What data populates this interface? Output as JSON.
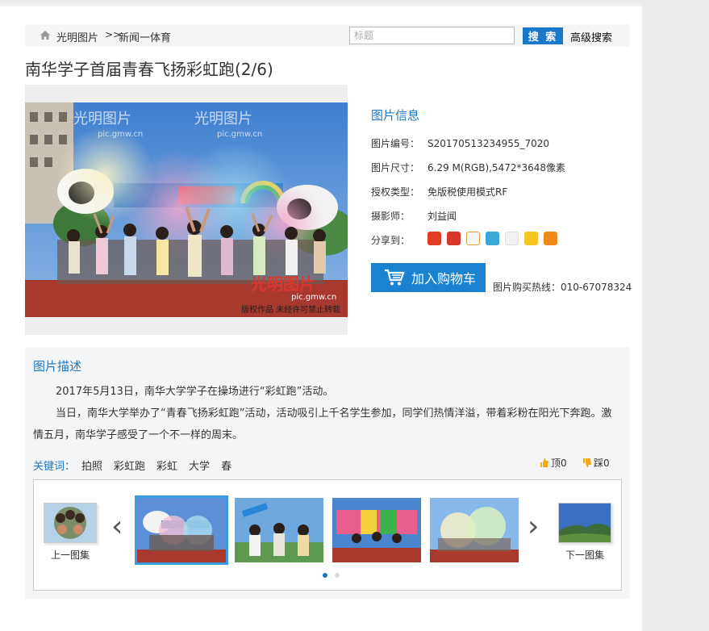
{
  "breadcrumb": {
    "home_label": "光明图片",
    "separator": ">>",
    "category": "新闻一体育"
  },
  "search": {
    "placeholder": "标题",
    "button_label": "搜 索",
    "advanced_label": "高级搜索"
  },
  "page_title": "南华学子首届青春飞扬彩虹跑(2/6)",
  "photo": {
    "watermark_brand": "光明图片",
    "watermark_url": "pic.gmw.cn",
    "copyright_note": "版权作品  未经许可禁止转载"
  },
  "info": {
    "title": "图片信息",
    "rows": [
      {
        "key": "图片编号：",
        "value": "S20170513234955_7020"
      },
      {
        "key": "图片尺寸：",
        "value": "6.29 M(RGB),5472*3648像素"
      },
      {
        "key": "授权类型：",
        "value": "免版税使用模式RF"
      },
      {
        "key": "摄影师：",
        "value": "刘益闻"
      }
    ],
    "share_label": "分享到：",
    "share_icons": [
      "google-plus-icon",
      "renren-icon",
      "weibo-icon",
      "pinterest-icon",
      "qq-icon",
      "qzone-icon",
      "bookmark-icon"
    ],
    "cart_label": "加入购物车",
    "hotline": "图片购买热线：010-67078324"
  },
  "description": {
    "title": "图片描述",
    "paragraph1": "2017年5月13日，南华大学学子在操场进行“彩虹跑”活动。",
    "paragraph2": "当日，南华大学举办了“青春飞扬彩虹跑”活动，活动吸引上千名学生参加，同学们热情洋溢，带着彩粉在阳光下奔跑。激情五月，南华学子感受了一个不一样的周末。",
    "keywords_label": "关键词：",
    "keywords": [
      "拍照",
      "彩虹跑",
      "彩虹",
      "大学",
      "春"
    ],
    "up_label": "顶0",
    "down_label": "踩0"
  },
  "gallery": {
    "prev_label": "上一图集",
    "next_label": "下一图集",
    "thumb_count": 5,
    "active_index": 0
  },
  "colors": {
    "accent": "#1a77c9",
    "cart": "#1b82d0"
  }
}
